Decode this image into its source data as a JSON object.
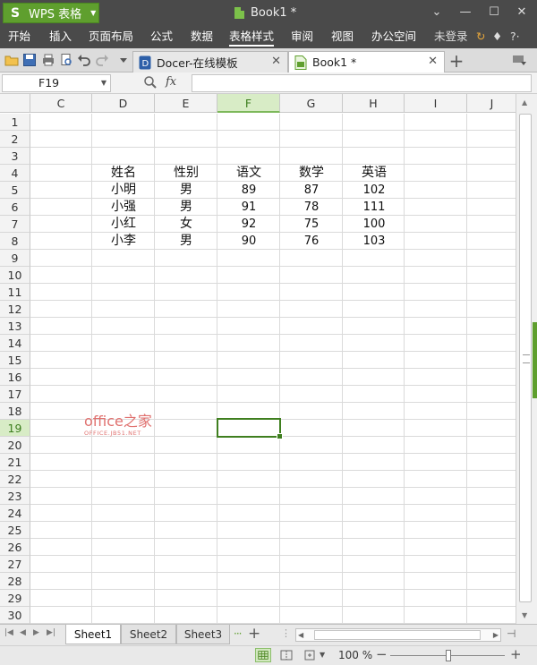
{
  "app": {
    "name": "WPS 表格",
    "document_title": "Book1 *"
  },
  "window_controls": {
    "dropdown": "⌄",
    "minimize": "—",
    "maximize": "☐",
    "close": "✕"
  },
  "menu": {
    "items": [
      "开始",
      "插入",
      "页面布局",
      "公式",
      "数据",
      "表格样式",
      "审阅",
      "视图",
      "办公空间"
    ],
    "active": "表格样式",
    "login": "未登录",
    "help": "?·"
  },
  "tabs": [
    {
      "label": "Docer-在线模板",
      "active": false
    },
    {
      "label": "Book1 *",
      "active": true
    }
  ],
  "formula_bar": {
    "name_box": "F19",
    "fx": "fx",
    "value": ""
  },
  "columns": [
    "C",
    "D",
    "E",
    "F",
    "G",
    "H",
    "I",
    "J"
  ],
  "selected_column": "F",
  "rows": [
    "1",
    "2",
    "3",
    "4",
    "5",
    "6",
    "7",
    "8",
    "9",
    "10",
    "11",
    "12",
    "13",
    "14",
    "15",
    "16",
    "17",
    "18",
    "19",
    "20",
    "21",
    "22",
    "23",
    "24",
    "25",
    "26",
    "27",
    "28",
    "29",
    "30"
  ],
  "selected_row": "19",
  "table": {
    "headers": [
      "姓名",
      "性别",
      "语文",
      "数学",
      "英语"
    ],
    "records": [
      [
        "小明",
        "男",
        "89",
        "87",
        "102"
      ],
      [
        "小强",
        "男",
        "91",
        "78",
        "111"
      ],
      [
        "小红",
        "女",
        "92",
        "75",
        "100"
      ],
      [
        "小李",
        "男",
        "90",
        "76",
        "103"
      ]
    ]
  },
  "watermark": {
    "main": "office之家",
    "sub": "OFFICE.JB51.NET"
  },
  "sheets": [
    "Sheet1",
    "Sheet2",
    "Sheet3"
  ],
  "active_sheet": "Sheet1",
  "status": {
    "zoom": "100 %",
    "zoom_level_percent": 100
  },
  "colors": {
    "accent": "#5f9f2e",
    "selection": "#3f7f1f",
    "title_bar": "#4a4a4a"
  }
}
